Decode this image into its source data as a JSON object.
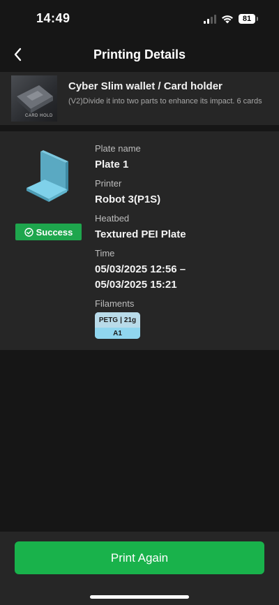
{
  "status_bar": {
    "time": "14:49",
    "battery": "81",
    "icons": [
      "signal-icon",
      "wifi-icon",
      "battery-icon"
    ]
  },
  "nav": {
    "back_icon": "chevron-left-icon",
    "title": "Printing Details"
  },
  "model": {
    "title": "Cyber Slim wallet / Card holder",
    "description": "(V2)Divide it into two parts to enhance its impact. 6 cards",
    "thumbnail_text": "CARD HOLD"
  },
  "print": {
    "status": "Success",
    "status_color": "#1ea64d",
    "plate_name_label": "Plate name",
    "plate_name": "Plate 1",
    "printer_label": "Printer",
    "printer": "Robot 3(P1S)",
    "heatbed_label": "Heatbed",
    "heatbed": "Textured PEI Plate",
    "time_label": "Time",
    "time_start": "05/03/2025 12:56 –",
    "time_end": "05/03/2025 15:21",
    "filaments_label": "Filaments",
    "filaments": [
      {
        "type": "PETG",
        "separator": "|",
        "weight": "21g",
        "slot": "A1",
        "color": "#8ad5ee"
      }
    ]
  },
  "actions": {
    "print_again": "Print Again",
    "accent_color": "#19b24b"
  }
}
